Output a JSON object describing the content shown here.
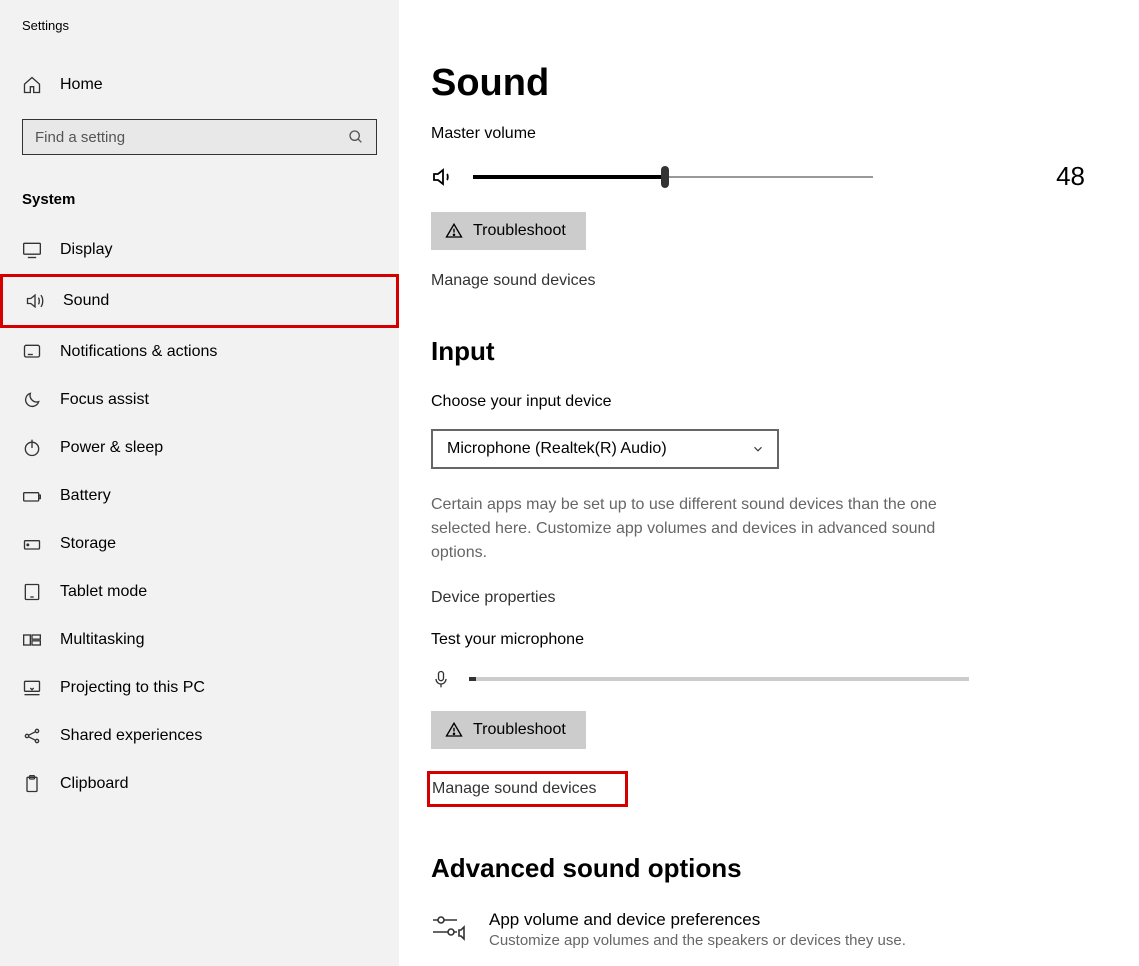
{
  "app": {
    "title": "Settings"
  },
  "sidebar": {
    "home": "Home",
    "search_placeholder": "Find a setting",
    "section": "System",
    "items": [
      {
        "label": "Display"
      },
      {
        "label": "Sound"
      },
      {
        "label": "Notifications & actions"
      },
      {
        "label": "Focus assist"
      },
      {
        "label": "Power & sleep"
      },
      {
        "label": "Battery"
      },
      {
        "label": "Storage"
      },
      {
        "label": "Tablet mode"
      },
      {
        "label": "Multitasking"
      },
      {
        "label": "Projecting to this PC"
      },
      {
        "label": "Shared experiences"
      },
      {
        "label": "Clipboard"
      }
    ]
  },
  "main": {
    "title": "Sound",
    "master_volume_label": "Master volume",
    "volume_value": "48",
    "troubleshoot": "Troubleshoot",
    "manage_devices": "Manage sound devices",
    "input_heading": "Input",
    "choose_input_label": "Choose your input device",
    "input_device": "Microphone (Realtek(R) Audio)",
    "input_help": "Certain apps may be set up to use different sound devices than the one selected here. Customize app volumes and devices in advanced sound options.",
    "device_properties": "Device properties",
    "test_mic": "Test your microphone",
    "troubleshoot2": "Troubleshoot",
    "manage_devices2": "Manage sound devices",
    "advanced_heading": "Advanced sound options",
    "adv_item_title": "App volume and device preferences",
    "adv_item_sub": "Customize app volumes and the speakers or devices they use."
  }
}
